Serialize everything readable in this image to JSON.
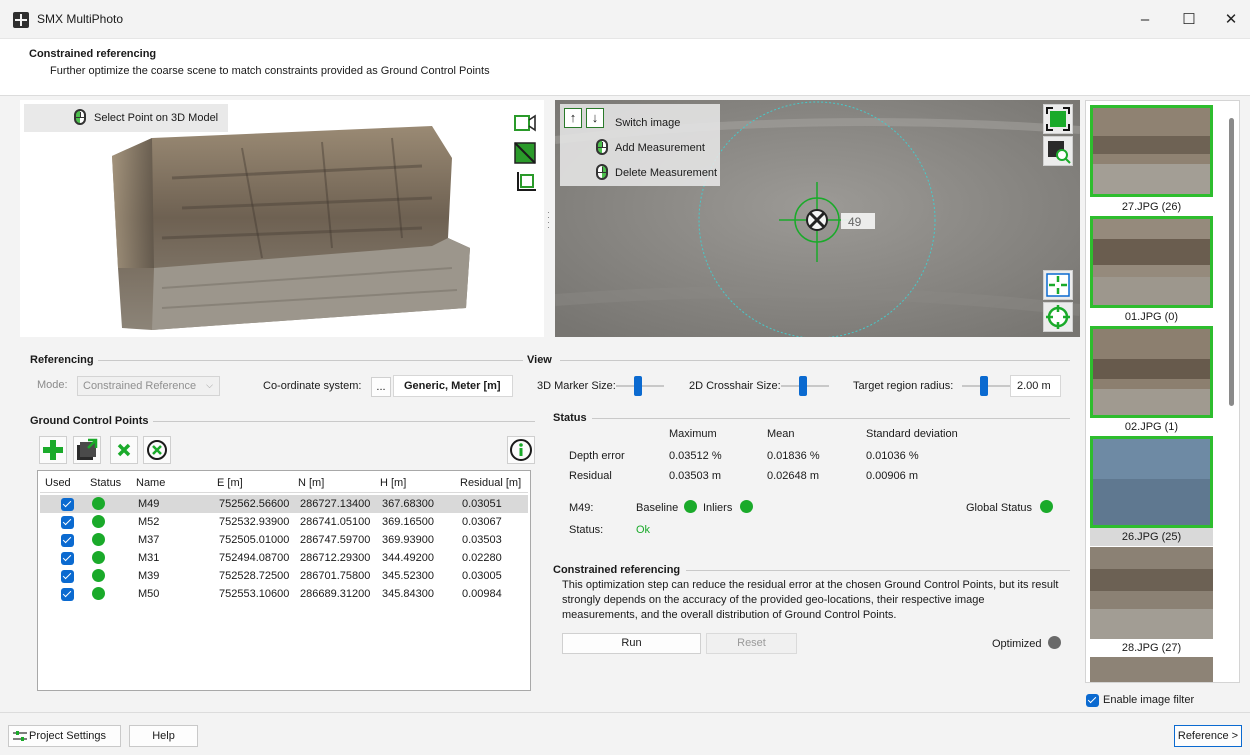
{
  "window": {
    "title": "SMX MultiPhoto",
    "minimize_glyph": "–",
    "maximize_glyph": "☐",
    "close_glyph": "✕"
  },
  "header": {
    "title": "Constrained referencing",
    "subtitle": "Further optimize the coarse scene to match constraints provided as Ground Control Points"
  },
  "viewport3d": {
    "hint": "Select Point on 3D Model",
    "tools": [
      "camera-icon",
      "plane-icon",
      "crop-icon"
    ]
  },
  "viewport2d": {
    "switch_image": "Switch image",
    "add_measurement": "Add Measurement",
    "delete_measurement": "Delete Measurement",
    "marker_label": "49",
    "up_glyph": "↑",
    "down_glyph": "↓",
    "tools_top": [
      "fit-icon",
      "zoom-icon"
    ],
    "tools_bottom": [
      "center-icon",
      "target-icon"
    ]
  },
  "referencing": {
    "section": "Referencing",
    "mode_label": "Mode:",
    "mode_value": "Constrained Reference",
    "coord_label": "Co-ordinate system:",
    "coord_button": "...",
    "coord_value": "Generic, Meter [m]"
  },
  "view": {
    "section": "View",
    "marker3d_label": "3D Marker Size:",
    "marker3d_level": 0.45,
    "crosshair2d_label": "2D Crosshair Size:",
    "crosshair2d_level": 0.45,
    "radius_label": "Target region radius:",
    "radius_level": 0.45,
    "radius_value": "2.00 m"
  },
  "gcp": {
    "section": "Ground Control Points",
    "toolbar": [
      "add-icon",
      "import-icon",
      "remove-icon",
      "clear-icon",
      "info-icon"
    ],
    "columns": [
      "Used",
      "Status",
      "Name",
      "E [m]",
      "N [m]",
      "H [m]",
      "Residual [m]"
    ],
    "rows": [
      {
        "name": "M49",
        "e": "752562.56600",
        "n": "286727.13400",
        "h": "367.68300",
        "residual": "0.03051"
      },
      {
        "name": "M52",
        "e": "752532.93900",
        "n": "286741.05100",
        "h": "369.16500",
        "residual": "0.03067"
      },
      {
        "name": "M37",
        "e": "752505.01000",
        "n": "286747.59700",
        "h": "369.93900",
        "residual": "0.03503"
      },
      {
        "name": "M31",
        "e": "752494.08700",
        "n": "286712.29300",
        "h": "344.49200",
        "residual": "0.02280"
      },
      {
        "name": "M39",
        "e": "752528.72500",
        "n": "286701.75800",
        "h": "345.52300",
        "residual": "0.03005"
      },
      {
        "name": "M50",
        "e": "752553.10600",
        "n": "286689.31200",
        "h": "345.84300",
        "residual": "0.00984"
      }
    ]
  },
  "status": {
    "section": "Status",
    "col_max": "Maximum",
    "col_mean": "Mean",
    "col_std": "Standard deviation",
    "depth_label": "Depth error",
    "depth_max": "0.03512 %",
    "depth_mean": "0.01836 %",
    "depth_std": "0.01036 %",
    "residual_label": "Residual",
    "residual_max": "0.03503 m",
    "residual_mean": "0.02648 m",
    "residual_std": "0.00906 m",
    "point_label": "M49:",
    "baseline_label": "Baseline",
    "inliers_label": "Inliers",
    "global_label": "Global Status",
    "status_label": "Status:",
    "status_value": "Ok"
  },
  "constrained": {
    "section": "Constrained referencing",
    "description": "This optimization step can reduce the residual error at the chosen Ground Control Points, but its result strongly depends on the accuracy of the provided geo-locations, their respective image measurements, and the overall distribution of Ground Control Points.",
    "run_label": "Run",
    "reset_label": "Reset",
    "optimized_label": "Optimized"
  },
  "thumbnails": {
    "items": [
      {
        "label": "27.JPG (26)"
      },
      {
        "label": "01.JPG (0)"
      },
      {
        "label": "02.JPG (1)"
      },
      {
        "label": "26.JPG (25)"
      },
      {
        "label": "28.JPG (27)"
      }
    ],
    "filter_label": "Enable image filter"
  },
  "footer": {
    "project_settings": "Project Settings",
    "help": "Help",
    "reference": "Reference >"
  },
  "colors": {
    "accent": "#0b6ad0",
    "ok_green": "#1aaa2a",
    "thumb_border": "#2ebd2e"
  }
}
